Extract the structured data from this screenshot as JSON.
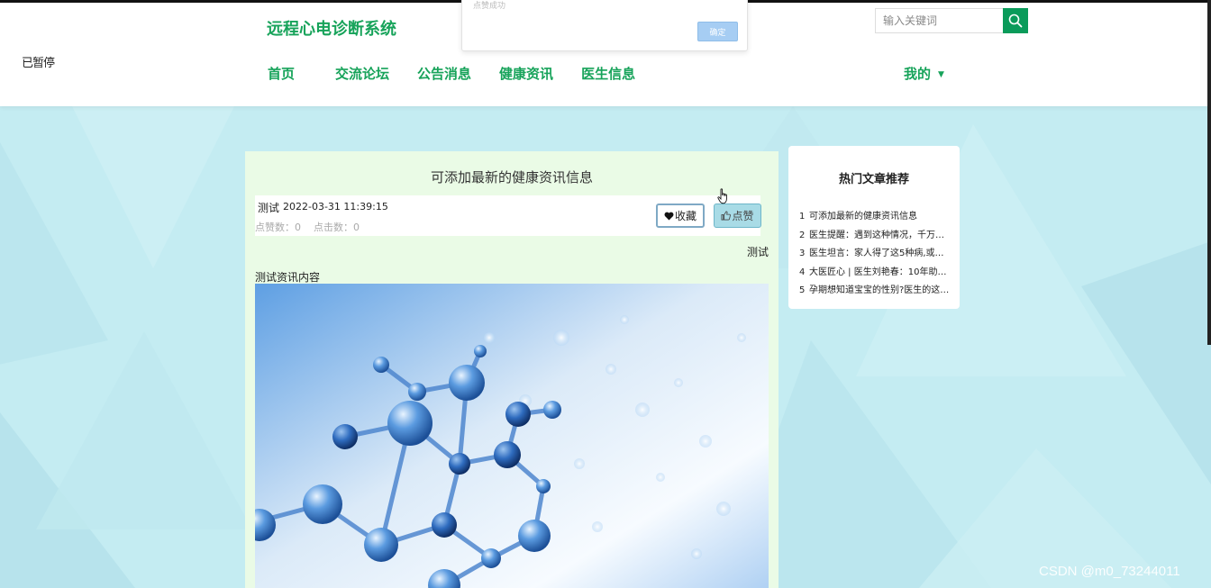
{
  "header": {
    "status_text": "已暂停",
    "site_title": "远程心电诊断系统",
    "nav": [
      "首页",
      "交流论坛",
      "公告消息",
      "健康资讯",
      "医生信息"
    ],
    "mine_label": "我的",
    "search_placeholder": "输入关键词"
  },
  "alert": {
    "message": "点赞成功",
    "confirm_label": "确定"
  },
  "article": {
    "title": "可添加最新的健康资讯信息",
    "author": "测试",
    "time": "2022-03-31 11:39:15",
    "likes_text": "点赞数：0",
    "clicks_text": "点击数：0",
    "favorite_label": "收藏",
    "like_label": "点赞",
    "category": "测试",
    "content": "测试资讯内容"
  },
  "sidebar": {
    "title": "热门文章推荐",
    "items": [
      {
        "num": "1",
        "text": "可添加最新的健康资讯信息"
      },
      {
        "num": "2",
        "text": "医生提醒：遇到这种情况，千万…"
      },
      {
        "num": "3",
        "text": "医生坦言：家人得了这5种病,或可…"
      },
      {
        "num": "4",
        "text": "大医匠心 | 医生刘艳春：10年助1…"
      },
      {
        "num": "5",
        "text": "孕期想知道宝宝的性别?医生的这…"
      }
    ]
  },
  "watermark": "CSDN @m0_73244011",
  "colors": {
    "brand_green": "#17a35a",
    "search_btn": "#0a9b5a",
    "page_bg": "#c4ecf2",
    "article_bg": "#eafbe6"
  }
}
